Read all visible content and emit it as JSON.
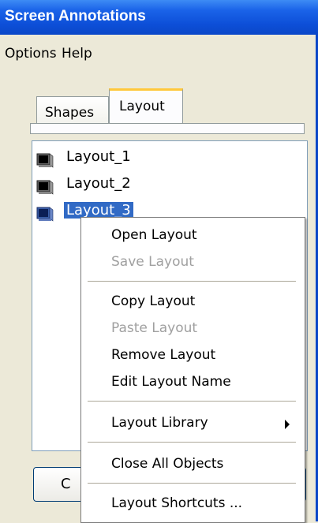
{
  "window": {
    "title": "Screen Annotations"
  },
  "menubar": {
    "items": [
      "Options",
      "Help"
    ]
  },
  "tabs": [
    {
      "label": "Shapes"
    },
    {
      "label": "Layout"
    }
  ],
  "tree": {
    "items": [
      {
        "label": "Layout_1"
      },
      {
        "label": "Layout_2"
      },
      {
        "label": "Layout_3"
      }
    ]
  },
  "bottom": {
    "button_partial": "C"
  },
  "context_menu": {
    "items": [
      {
        "label": "Open Layout"
      },
      {
        "label": "Save Layout"
      },
      {
        "label": "Copy Layout"
      },
      {
        "label": "Paste Layout"
      },
      {
        "label": "Remove Layout"
      },
      {
        "label": "Edit Layout Name"
      },
      {
        "label": "Layout Library"
      },
      {
        "label": "Close All Objects"
      },
      {
        "label": "Layout Shortcuts ..."
      }
    ]
  },
  "colors": {
    "titlebar": "#0a47c8",
    "selection": "#316ac5",
    "tab_accent": "#ffc83c"
  },
  "icons": {
    "tree_item": "layout-monitor-icon",
    "submenu": "submenu-arrow-icon"
  }
}
